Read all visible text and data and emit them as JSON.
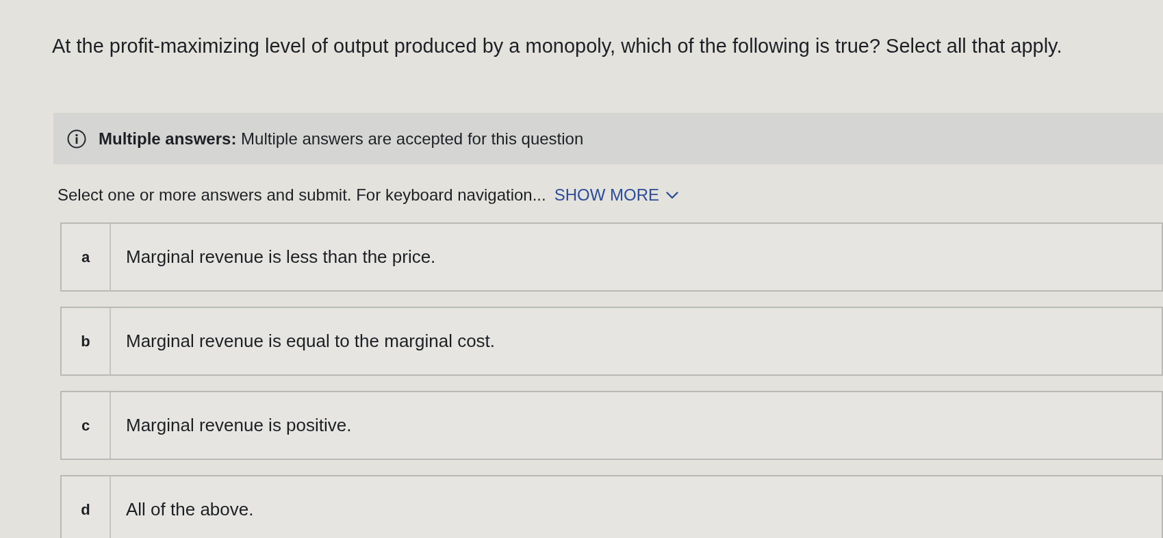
{
  "question": "At the profit-maximizing level of output produced by a monopoly, which of the following is true? Select all that apply.",
  "notice": {
    "text": "**Multiple answers:** Multiple answers are accepted for this question"
  },
  "instructions": {
    "text": "Select one or more answers and submit. For keyboard navigation...",
    "toggle": {
      "label": "SHOW MORE",
      "expanded": false
    }
  },
  "options": [
    {
      "letter": "a",
      "text": "Marginal revenue is less than the price.",
      "selected": false
    },
    {
      "letter": "b",
      "text": "Marginal revenue is equal to the marginal cost.",
      "selected": false
    },
    {
      "letter": "c",
      "text": "Marginal revenue is positive.",
      "selected": false
    },
    {
      "letter": "d",
      "text": "All of the above.",
      "selected": false
    }
  ]
}
